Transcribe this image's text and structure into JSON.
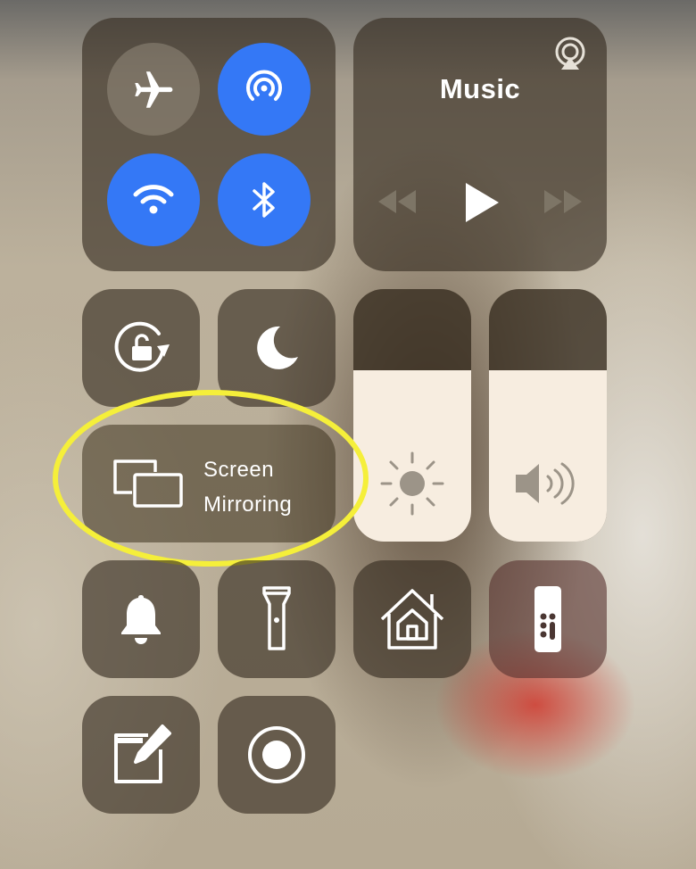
{
  "connectivity": {
    "airplane": {
      "icon": "airplane-icon",
      "state": "off"
    },
    "airdrop": {
      "icon": "airdrop-icon",
      "state": "on"
    },
    "wifi": {
      "icon": "wifi-icon",
      "state": "on"
    },
    "bluetooth": {
      "icon": "bluetooth-icon",
      "state": "on"
    }
  },
  "music": {
    "title": "Music",
    "airplay_icon": "airplay-icon",
    "controls": [
      "rewind-icon",
      "play-icon",
      "fast-forward-icon"
    ]
  },
  "toggles": {
    "orientation_lock": "orientation-lock-icon",
    "do_not_disturb": "moon-icon"
  },
  "screen_mirroring": {
    "line1": "Screen",
    "line2": "Mirroring",
    "icon": "screen-mirroring-icon"
  },
  "brightness": {
    "level": 0.68,
    "icon": "sun-icon"
  },
  "volume": {
    "level": 0.68,
    "icon": "speaker-icon"
  },
  "shortcuts": [
    "bell-icon",
    "flashlight-icon",
    "home-icon",
    "apple-tv-remote-icon",
    "notes-icon",
    "screen-record-icon"
  ],
  "colors": {
    "accent": "#3478f6",
    "highlight": "#f5ef3a",
    "slider_fill": "#f7ede0"
  }
}
